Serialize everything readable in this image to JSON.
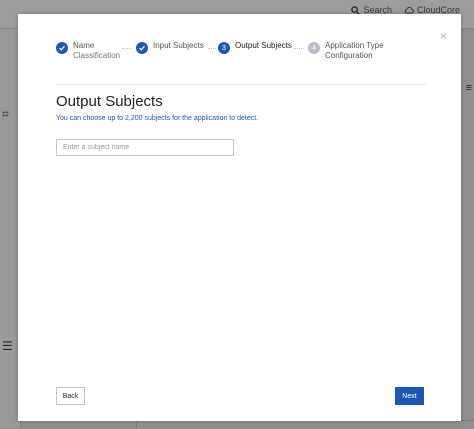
{
  "background": {
    "search_label": "Search",
    "cloud_label": "CloudCore"
  },
  "modal": {
    "close_glyph": "×",
    "steps": [
      {
        "label": "Name",
        "sub": "Classification",
        "state": "done"
      },
      {
        "label": "Input Subjects",
        "sub": "",
        "state": "done"
      },
      {
        "label": "Output Subjects",
        "sub": "",
        "state": "active",
        "number": "3"
      },
      {
        "label": "Application Type Configuration",
        "sub": "",
        "state": "pending",
        "number": "4"
      }
    ],
    "title": "Output Subjects",
    "subtitle": "You can choose up to 2,200 subjects for the application to detect.",
    "input_placeholder": "Enter a subject name",
    "input_value": "",
    "back_label": "Back",
    "next_label": "Next"
  },
  "colors": {
    "primary": "#1f57b4",
    "pending": "#b7bec8",
    "overlay": "#8f8f8f"
  }
}
